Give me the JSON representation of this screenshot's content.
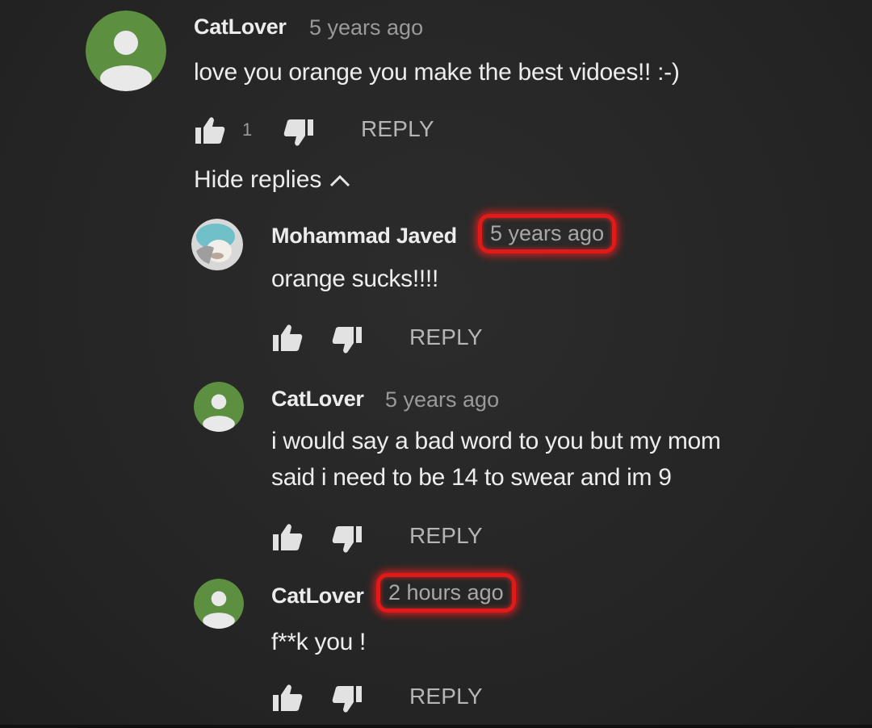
{
  "comments": [
    {
      "author": "CatLover",
      "time": "5 years ago",
      "text_lines": [
        "love you orange you make the best vidoes!! :-)"
      ],
      "likes": "1",
      "reply_label": "REPLY",
      "avatar": "default-user-avatar-green",
      "time_highlighted": false
    },
    {
      "author": "Mohammad Javed",
      "time": "5 years ago",
      "text_lines": [
        "orange sucks!!!!"
      ],
      "likes": "",
      "reply_label": "REPLY",
      "avatar": "photo-avatar",
      "time_highlighted": true
    },
    {
      "author": "CatLover",
      "time": "5 years ago",
      "text_lines": [
        "i would say a bad word to you but my mom",
        "said i need to be 14 to swear and im 9"
      ],
      "likes": "",
      "reply_label": "REPLY",
      "avatar": "default-user-avatar-green",
      "time_highlighted": false
    },
    {
      "author": "CatLover",
      "time": "2 hours ago",
      "text_lines": [
        "f**k you !"
      ],
      "likes": "",
      "reply_label": "REPLY",
      "avatar": "default-user-avatar-green",
      "time_highlighted": true
    }
  ],
  "hide_replies_label": "Hide replies",
  "colors": {
    "background": "#262626",
    "avatar_green": "#5c8f3f",
    "highlight_red": "#e01919",
    "muted_text": "#9a9a9a"
  }
}
